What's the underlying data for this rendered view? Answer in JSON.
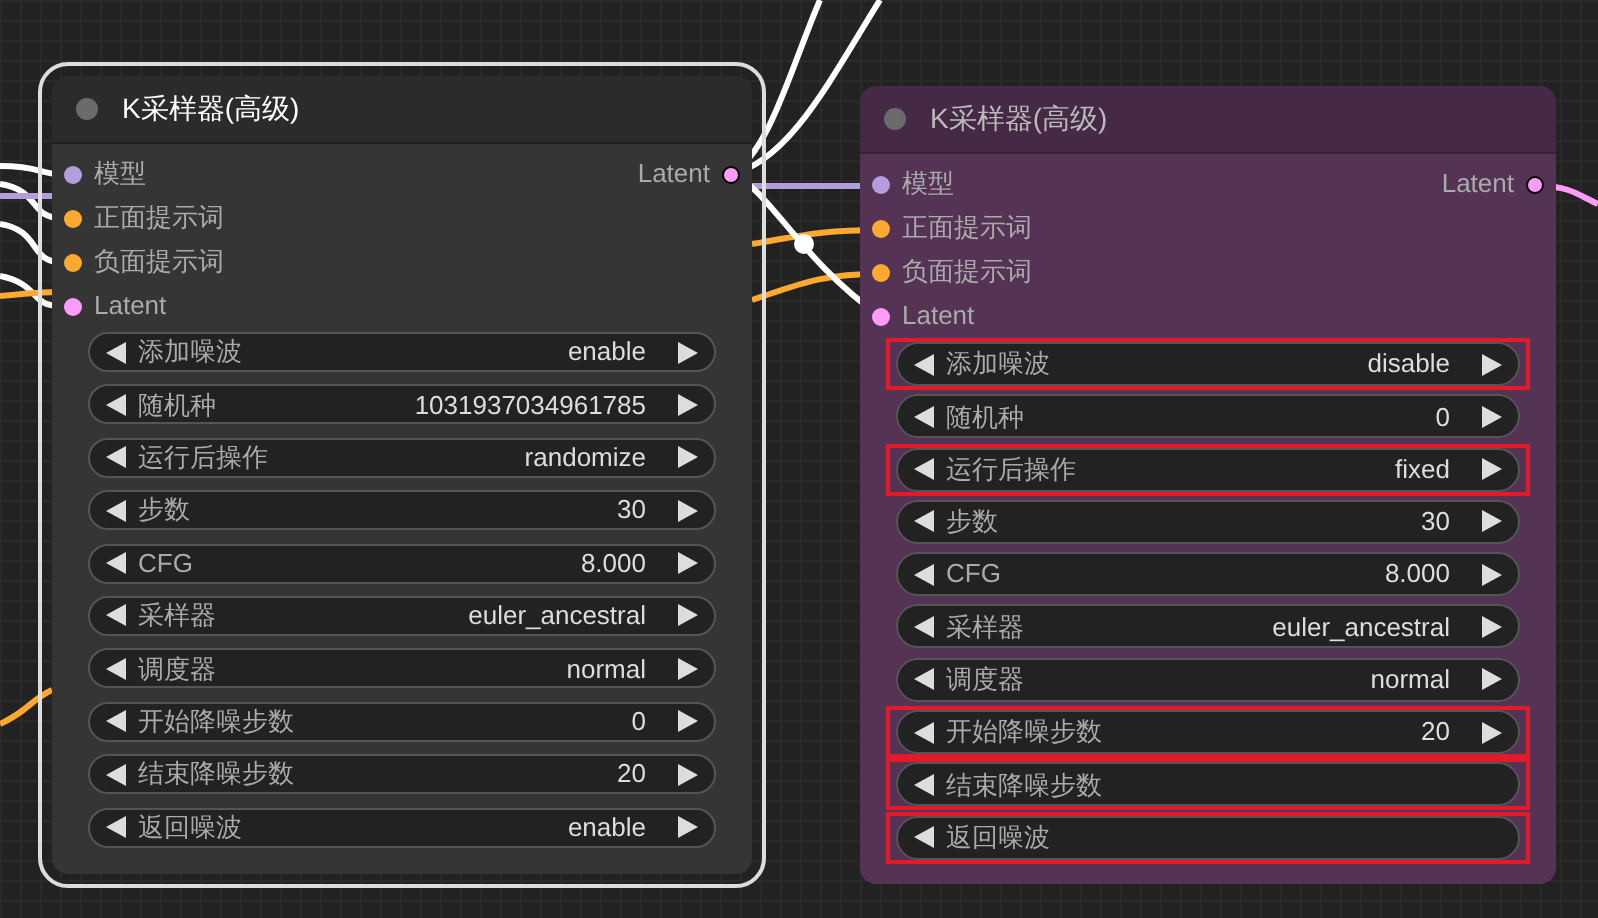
{
  "nodes": [
    {
      "title": "K采样器(高级)",
      "selected": true,
      "color": "#353535",
      "inputs": [
        {
          "label": "模型",
          "color": "#b39ddb"
        },
        {
          "label": "正面提示词",
          "color": "#ffa931"
        },
        {
          "label": "负面提示词",
          "color": "#ffa931"
        },
        {
          "label": "Latent",
          "color": "#ff9cf9"
        }
      ],
      "outputs": [
        {
          "label": "Latent",
          "color": "#ff9cf9"
        }
      ],
      "widgets": [
        {
          "label": "添加噪波",
          "value": "enable",
          "highlighted": false
        },
        {
          "label": "随机种",
          "value": "1031937034961785",
          "highlighted": false
        },
        {
          "label": "运行后操作",
          "value": "randomize",
          "highlighted": false
        },
        {
          "label": "步数",
          "value": "30",
          "highlighted": false
        },
        {
          "label": "CFG",
          "value": "8.000",
          "highlighted": false
        },
        {
          "label": "采样器",
          "value": "euler_ancestral",
          "highlighted": false
        },
        {
          "label": "调度器",
          "value": "normal",
          "highlighted": false
        },
        {
          "label": "开始降噪步数",
          "value": "0",
          "highlighted": false
        },
        {
          "label": "结束降噪步数",
          "value": "20",
          "highlighted": false
        },
        {
          "label": "返回噪波",
          "value": "enable",
          "highlighted": false
        }
      ]
    },
    {
      "title": "K采样器(高级)",
      "selected": false,
      "color": "#553355",
      "inputs": [
        {
          "label": "模型",
          "color": "#b39ddb"
        },
        {
          "label": "正面提示词",
          "color": "#ffa931"
        },
        {
          "label": "负面提示词",
          "color": "#ffa931"
        },
        {
          "label": "Latent",
          "color": "#ff9cf9"
        }
      ],
      "outputs": [
        {
          "label": "Latent",
          "color": "#ff9cf9"
        }
      ],
      "widgets": [
        {
          "label": "添加噪波",
          "value": "disable",
          "highlighted": true
        },
        {
          "label": "随机种",
          "value": "0",
          "highlighted": false
        },
        {
          "label": "运行后操作",
          "value": "fixed",
          "highlighted": true
        },
        {
          "label": "步数",
          "value": "30",
          "highlighted": false
        },
        {
          "label": "CFG",
          "value": "8.000",
          "highlighted": false
        },
        {
          "label": "采样器",
          "value": "euler_ancestral",
          "highlighted": false
        },
        {
          "label": "调度器",
          "value": "normal",
          "highlighted": false
        },
        {
          "label": "开始降噪步数",
          "value": "20",
          "highlighted": true
        },
        {
          "label": "结束降噪步数",
          "highlighted": true
        },
        {
          "label": "返回噪波",
          "highlighted": true
        }
      ]
    }
  ]
}
